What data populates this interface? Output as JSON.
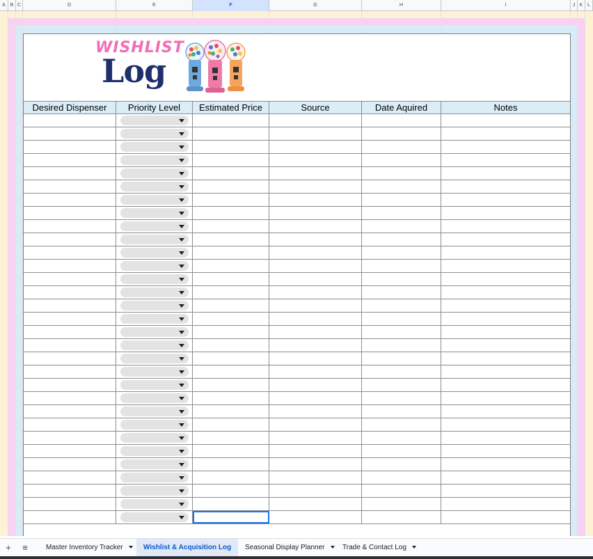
{
  "columns": [
    {
      "label": "A",
      "selected": false
    },
    {
      "label": "B",
      "selected": false
    },
    {
      "label": "C",
      "selected": false
    },
    {
      "label": "D",
      "selected": false
    },
    {
      "label": "E",
      "selected": false
    },
    {
      "label": "F",
      "selected": true
    },
    {
      "label": "G",
      "selected": false
    },
    {
      "label": "H",
      "selected": false
    },
    {
      "label": "I",
      "selected": false
    },
    {
      "label": "J",
      "selected": false
    },
    {
      "label": "K",
      "selected": false
    },
    {
      "label": "L",
      "selected": false
    }
  ],
  "logo": {
    "line1": "WISHLIST",
    "line2": "Log",
    "image_icon": "gumball-machines-icon"
  },
  "table": {
    "headers": [
      "Desired Dispenser",
      "Priority Level",
      "Estimated Price",
      "Source",
      "Date Aquired",
      "Notes"
    ],
    "row_count": 31,
    "dropdown_column": 1
  },
  "colors": {
    "band_yellow": "#fdf2d5",
    "band_pink": "#f8d2f2",
    "band_blue": "#d7ecf6",
    "header_fill": "#dbeef8",
    "chip_fill": "#e3e3e3",
    "active_tab": "#0b57d0"
  },
  "tabs": {
    "add_icon": "+",
    "menu_icon": "≡",
    "items": [
      {
        "label": "Master Inventory Tracker",
        "active": false
      },
      {
        "label": "Wishlist & Acquisition Log",
        "active": true
      },
      {
        "label": "Seasonal Display Planner",
        "active": false
      },
      {
        "label": "Trade & Contact Log",
        "active": false
      }
    ]
  }
}
